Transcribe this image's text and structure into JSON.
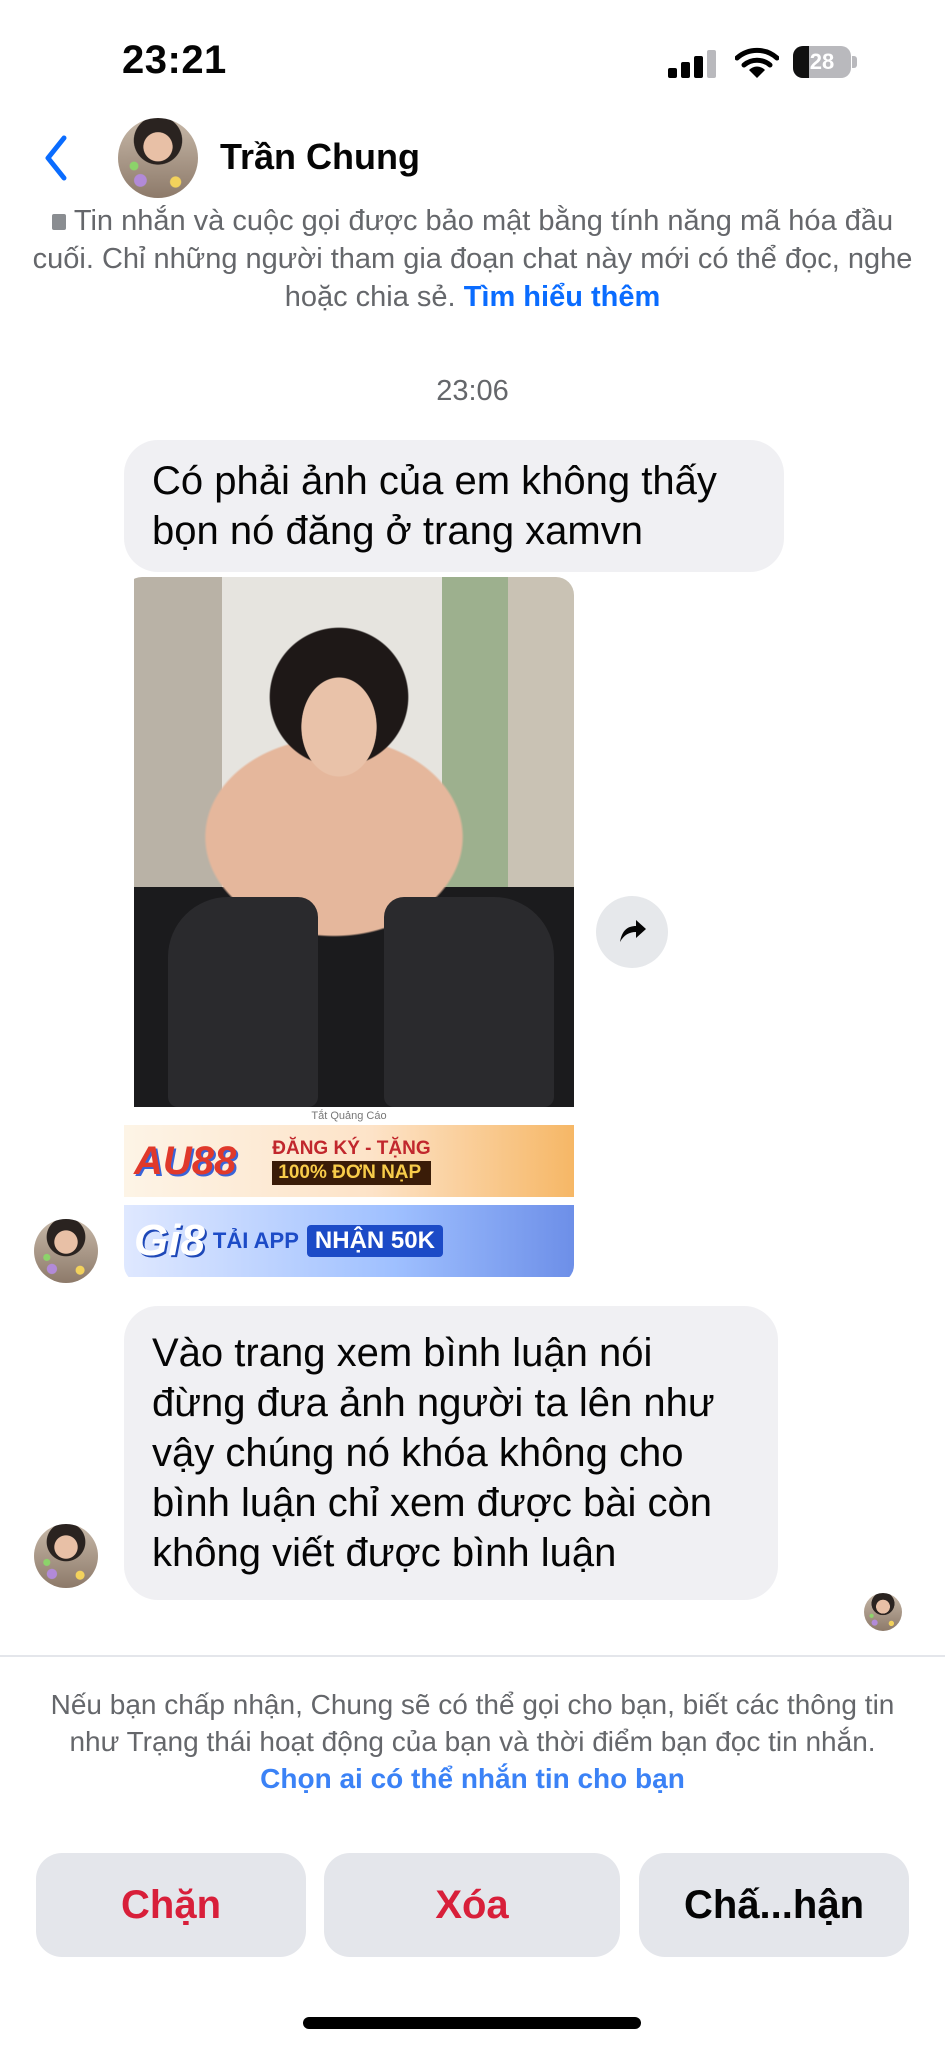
{
  "status_bar": {
    "time": "23:21",
    "battery": "28",
    "battery_level": 0.28
  },
  "header": {
    "contact_name": "Trần Chung"
  },
  "encryption_notice": {
    "text": "Tin nhắn và cuộc gọi được bảo mật bằng tính năng mã hóa đầu cuối. Chỉ những người tham gia đoạn chat này mới có thể đọc, nghe hoặc chia sẻ. ",
    "link": "Tìm hiểu thêm"
  },
  "messages": {
    "timestamp": "23:06",
    "msg1": "Có phải ảnh của em không thấy bọn nó đăng ở trang xamvn",
    "photo_caption": "Tắt Quảng Cáo",
    "ad1": {
      "brand": "AU88",
      "line1": "ĐĂNG KÝ - TẶNG",
      "line2": "100% ĐƠN NẠP"
    },
    "ad2": {
      "brand": "Gi8",
      "app": "TẢI APP",
      "cta": "NHẬN 50K"
    },
    "msg2": "Vào trang xem bình luận nói đừng đưa ảnh người ta lên như vậy chúng nó khóa không cho bình luận chỉ xem được bài còn không viết được bình luận"
  },
  "request_notice": {
    "text": "Nếu bạn chấp nhận, Chung sẽ có thể gọi cho bạn, biết các thông tin như Trạng thái hoạt động của bạn và thời điểm bạn đọc tin nhắn. ",
    "link": "Chọn ai có thể nhắn tin cho bạn"
  },
  "actions": {
    "block": "Chặn",
    "delete": "Xóa",
    "accept": "Chấ...hận"
  },
  "icons": {
    "back": "chevron-left-icon",
    "share": "share-arrow-icon",
    "lock": "lock-icon",
    "signal": "cellular-signal-icon",
    "wifi": "wifi-icon",
    "battery": "battery-icon"
  },
  "colors": {
    "accent": "#0a6cff",
    "danger": "#d81f3a",
    "bubble": "#f0f0f3",
    "button": "#e4e6eb"
  }
}
